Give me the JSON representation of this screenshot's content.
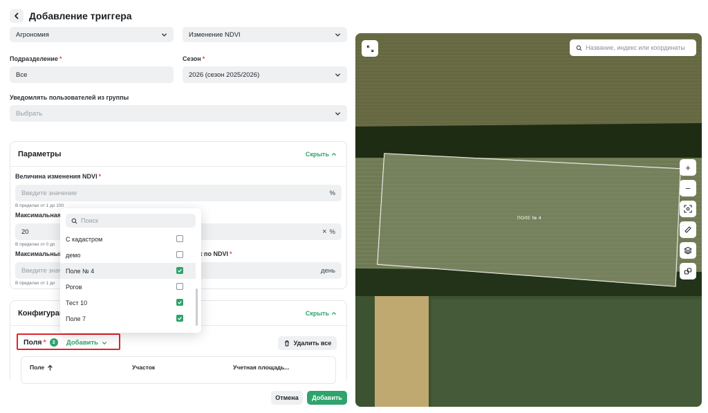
{
  "header": {
    "title": "Добавление триггера"
  },
  "form": {
    "category_value": "Агрономия",
    "event_value": "Изменение NDVI",
    "division_label": "Подразделение",
    "division_value": "Все",
    "season_label": "Сезон",
    "season_value": "2026 (сезон 2025/2026)",
    "notify_label": "Уведомлять пользователей из группы",
    "notify_placeholder": "Выбрать"
  },
  "params": {
    "title": "Параметры",
    "hide_label": "Скрыть",
    "ndvi_change_label": "Величина изменения NDVI",
    "ndvi_change_placeholder": "Введите значение",
    "ndvi_change_unit": "%",
    "ndvi_change_hint": "В пределах от 1 до 100",
    "max_label": "Максимальная",
    "max_value": "20",
    "max_clear": "×",
    "max_unit": "%",
    "max_hint": "В пределах от 0 до",
    "max2_label": "Максимальный",
    "max2_label_tail": "к по NDVI",
    "max2_placeholder": "Введите значе",
    "max2_unit": "день",
    "max2_hint": "В пределах от 1 до"
  },
  "config": {
    "title": "Конфигураци",
    "hide_label": "Скрыть",
    "fields_label": "Поля",
    "fields_count": "3",
    "add_label": "Добавить",
    "delete_all_label": "Удалить все",
    "columns": [
      "Поле",
      "Участок",
      "Учетная площадь..."
    ]
  },
  "footer": {
    "cancel_label": "Отмена",
    "submit_label": "Добавить"
  },
  "dropdown": {
    "search_placeholder": "Поиск",
    "items": [
      {
        "label": "С кадастром",
        "checked": false
      },
      {
        "label": "демо",
        "checked": false
      },
      {
        "label": "Поле № 4",
        "checked": true
      },
      {
        "label": "Рогов",
        "checked": false
      },
      {
        "label": "Тест 10",
        "checked": true
      },
      {
        "label": "Поле 7",
        "checked": true
      }
    ]
  },
  "map": {
    "search_placeholder": "Название, индекс или координаты",
    "field_label": "ПОЛЕ № 4"
  },
  "colors": {
    "accent": "#2fa36b",
    "required": "#e5484d",
    "highlight_border": "#e0242b"
  }
}
